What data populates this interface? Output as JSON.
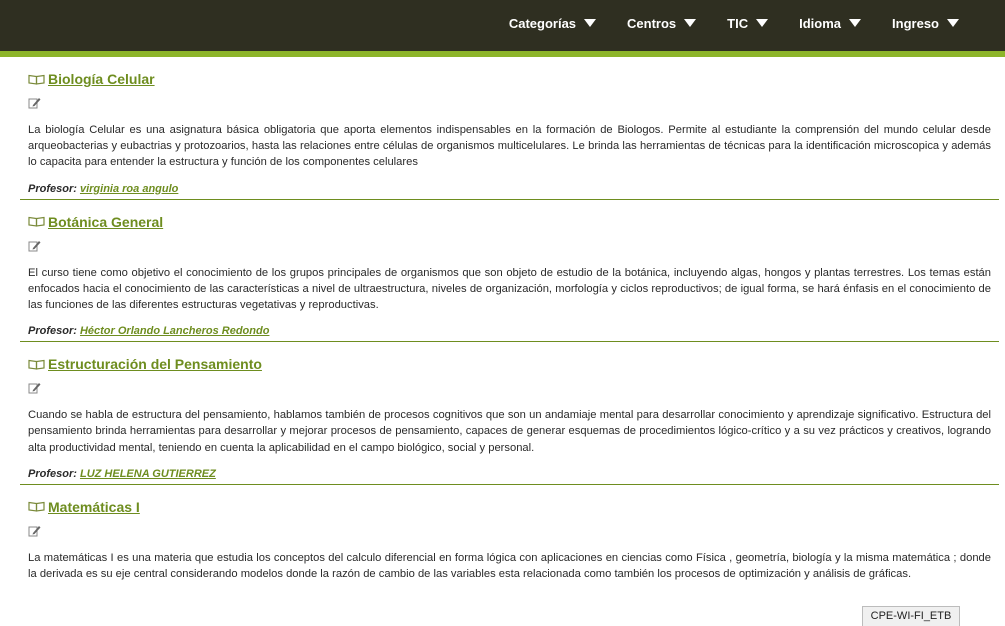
{
  "nav": {
    "items": [
      {
        "label": "Categorías"
      },
      {
        "label": "Centros"
      },
      {
        "label": "TIC"
      },
      {
        "label": "Idioma"
      },
      {
        "label": "Ingreso"
      }
    ]
  },
  "courses": [
    {
      "title": "Biología Celular",
      "description": "La biología Celular es una asignatura básica obligatoria que aporta elementos indispensables en la formación de Biologos. Permite al estudiante la comprensión del mundo celular desde arqueobacterias y eubactrias y protozoarios, hasta las relaciones entre células de organismos multicelulares. Le brinda las herramientas de técnicas para la identificación microscopica y además lo capacita para entender la estructura y función de los componentes celulares",
      "prof_label": "Profesor:",
      "professor": "virginia roa angulo"
    },
    {
      "title": "Botánica General",
      "description": "El curso tiene como objetivo el conocimiento de los grupos principales de organismos que son objeto de estudio de la botánica, incluyendo algas, hongos y plantas terrestres. Los temas están enfocados hacia el conocimiento de las características a nivel de ultraestructura, niveles de organización, morfología y ciclos reproductivos; de igual forma, se hará énfasis en el conocimiento de las funciones de las diferentes estructuras vegetativas y reproductivas.",
      "prof_label": "Profesor:",
      "professor": "Héctor Orlando Lancheros Redondo"
    },
    {
      "title": "Estructuración del Pensamiento",
      "description": "Cuando se habla de estructura del pensamiento, hablamos también de procesos cognitivos que son un andamiaje mental para desarrollar conocimiento y aprendizaje significativo.  Estructura del pensamiento brinda herramientas para desarrollar y mejorar procesos de pensamiento, capaces de  generar esquemas de procedimientos lógico-crítico y a su vez prácticos y creativos, logrando alta productividad mental, teniendo en cuenta la aplicabilidad en el campo biológico, social y personal.",
      "prof_label": "Profesor:",
      "professor": "LUZ HELENA GUTIERREZ"
    },
    {
      "title": "Matemáticas I",
      "description": "La matemáticas I es una materia que estudia los conceptos del calculo diferencial en forma lógica con aplicaciones en ciencias como Física , geometría, biología y la misma matemática ; donde la derivada  es su eje central considerando modelos donde la razón de cambio de las variables esta relacionada como también los procesos de optimización y análisis de gráficas.",
      "prof_label": "",
      "professor": ""
    }
  ],
  "status": {
    "wifi": "CPE-WI-FI_ETB"
  },
  "colors": {
    "topbar": "#2f2f21",
    "accent": "#8db52a",
    "link": "#6e8d1f"
  }
}
